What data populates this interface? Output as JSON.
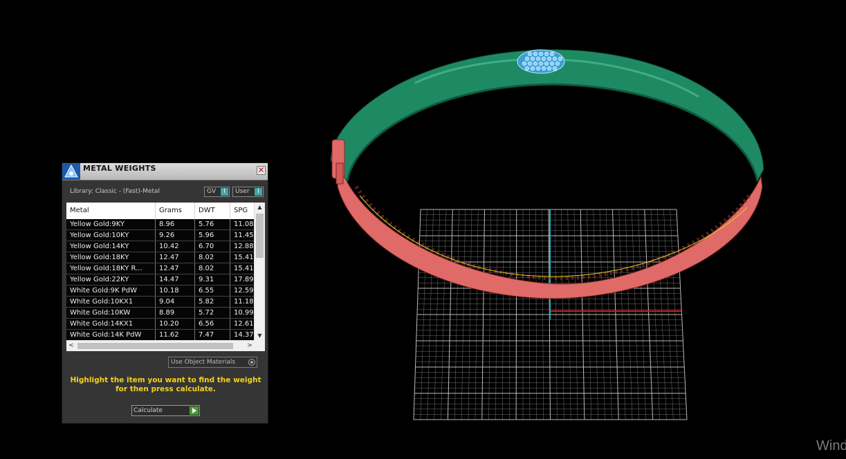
{
  "panel": {
    "title": "METAL WEIGHTS",
    "close_glyph": "✕",
    "library_label": "Library: Classic - (Fast)-Metal",
    "gv_label": "GV",
    "user_label": "User",
    "toggle_glyph": "I",
    "use_object_materials": "Use Object Materials",
    "hint": "Highlight the item you want to find the weight for then press calculate.",
    "calculate_label": "Calculate"
  },
  "table": {
    "columns": [
      "Metal",
      "Grams",
      "DWT",
      "SPG"
    ],
    "rows": [
      [
        "Yellow Gold:9KY",
        "8.96",
        "5.76",
        "11.08"
      ],
      [
        "Yellow Gold:10KY",
        "9.26",
        "5.96",
        "11.45"
      ],
      [
        "Yellow Gold:14KY",
        "10.42",
        "6.70",
        "12.88"
      ],
      [
        "Yellow Gold:18KY",
        "12.47",
        "8.02",
        "15.41"
      ],
      [
        "Yellow Gold:18KY R...",
        "12.47",
        "8.02",
        "15.41"
      ],
      [
        "Yellow Gold:22KY",
        "14.47",
        "9.31",
        "17.89"
      ],
      [
        "White Gold:9K PdW",
        "10.18",
        "6.55",
        "12.59"
      ],
      [
        "White Gold:10KX1",
        "9.04",
        "5.82",
        "11.18"
      ],
      [
        "White Gold:10KW",
        "8.89",
        "5.72",
        "10.99"
      ],
      [
        "White Gold:14KX1",
        "10.20",
        "6.56",
        "12.61"
      ],
      [
        "White Gold:14K PdW",
        "11.62",
        "7.47",
        "14.37"
      ]
    ]
  },
  "scroll_glyphs": {
    "up": "▲",
    "down": "▼",
    "left": "<",
    "right": ">"
  },
  "watermark": "Wind",
  "colors": {
    "band_green": "#1e8a64",
    "band_red": "#e06a68",
    "grid": "#cfcfcf",
    "axis_cyan": "#20b0c0",
    "axis_red": "#d02020",
    "hint_yellow": "#f3d21c",
    "stones": "#8fd0ff"
  }
}
